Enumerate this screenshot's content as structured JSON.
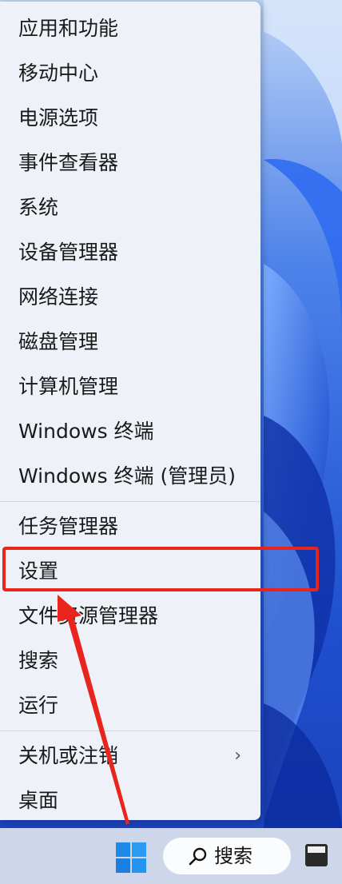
{
  "menu": {
    "group1": [
      {
        "label": "应用和功能"
      },
      {
        "label": "移动中心"
      },
      {
        "label": "电源选项"
      },
      {
        "label": "事件查看器"
      },
      {
        "label": "系统"
      },
      {
        "label": "设备管理器"
      },
      {
        "label": "网络连接"
      },
      {
        "label": "磁盘管理"
      },
      {
        "label": "计算机管理"
      },
      {
        "label": "Windows 终端"
      },
      {
        "label": "Windows 终端 (管理员)"
      }
    ],
    "group2": [
      {
        "label": "任务管理器"
      },
      {
        "label": "设置"
      },
      {
        "label": "文件资源管理器"
      },
      {
        "label": "搜索"
      },
      {
        "label": "运行"
      }
    ],
    "group3": [
      {
        "label": "关机或注销",
        "chevron": "›"
      },
      {
        "label": "桌面"
      }
    ]
  },
  "taskbar": {
    "search_label": "搜索",
    "start_icon": "windows-logo-icon",
    "search_icon": "search-icon"
  },
  "annotation": {
    "highlight_color": "#e8241d",
    "highlighted_item": "设置"
  },
  "colors": {
    "menu_bg": "#eef1f7",
    "wallpaper": "#2b5fd9",
    "accent_start": "#1e8ae8"
  }
}
